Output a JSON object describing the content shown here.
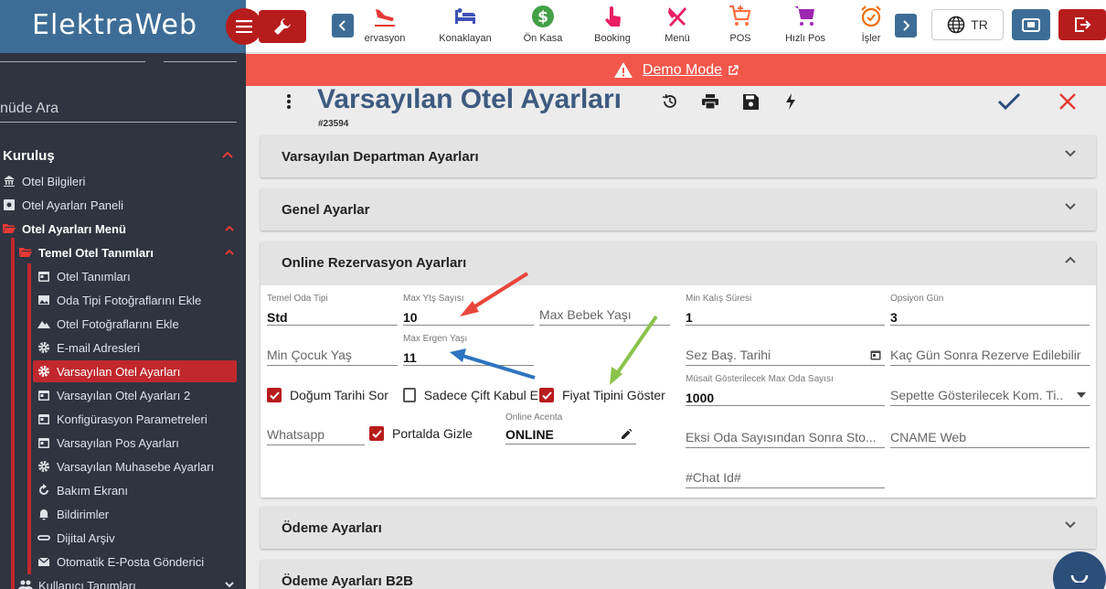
{
  "app": {
    "logo": "ElektraWeb"
  },
  "sidebar": {
    "search_placeholder": "nüde Ara",
    "section": "Kuruluş",
    "items": [
      {
        "label": "Otel Bilgileri"
      },
      {
        "label": "Otel Ayarları Paneli"
      },
      {
        "label": "Otel Ayarları Menü"
      },
      {
        "label": "Temel Otel Tanımları"
      },
      {
        "label": "Otel Tanımları"
      },
      {
        "label": "Oda Tipi Fotoğraflarını Ekle"
      },
      {
        "label": "Otel Fotoğraflarını Ekle"
      },
      {
        "label": "E-mail Adresleri"
      },
      {
        "label": "Varsayılan Otel Ayarları"
      },
      {
        "label": "Varsayılan Otel Ayarları 2"
      },
      {
        "label": "Konfigürasyon Parametreleri"
      },
      {
        "label": "Varsayılan Pos Ayarları"
      },
      {
        "label": "Varsayılan Muhasebe Ayarları"
      },
      {
        "label": "Bakım Ekranı"
      },
      {
        "label": "Bildirimler"
      },
      {
        "label": "Dijital Arşiv"
      },
      {
        "label": "Otomatik E-Posta Gönderici"
      },
      {
        "label": "Kullanıcı Tanımları"
      }
    ]
  },
  "topbar": {
    "modules": [
      {
        "label": "ervasyon",
        "color": "#e53935"
      },
      {
        "label": "Konaklayan",
        "color": "#3f51b5"
      },
      {
        "label": "Ön Kasa",
        "color": "#43a047"
      },
      {
        "label": "Booking",
        "color": "#e91e63"
      },
      {
        "label": "Menü",
        "color": "#e91e63"
      },
      {
        "label": "POS",
        "color": "#ff7043"
      },
      {
        "label": "Hızlı Pos",
        "color": "#9c27b0"
      },
      {
        "label": "İşler",
        "color": "#ef6c00"
      }
    ],
    "language": "TR"
  },
  "demo_banner": {
    "text": "Demo Mode"
  },
  "page": {
    "title": "Varsayılan Otel Ayarları",
    "id": "#23594"
  },
  "panels": [
    {
      "title": "Varsayılan Departman Ayarları"
    },
    {
      "title": "Genel Ayarlar"
    },
    {
      "title": "Online Rezervasyon Ayarları"
    },
    {
      "title": "Ödeme Ayarları"
    },
    {
      "title": "Ödeme Ayarları B2B"
    }
  ],
  "form": {
    "temel_oda_tipi": {
      "label": "Temel Oda Tipi",
      "value": "Std"
    },
    "max_yts_sayisi": {
      "label": "Max Ytş Sayısı",
      "value": "10"
    },
    "max_bebek_yasi": {
      "placeholder": "Max Bebek Yaşı"
    },
    "min_kalis_suresi": {
      "label": "Min Kalış Süresi",
      "value": "1"
    },
    "opsiyon_gun": {
      "label": "Opsiyon Gün",
      "value": "3"
    },
    "min_cocuk_yas": {
      "placeholder": "Min Çocuk Yaş"
    },
    "max_ergen_yasi": {
      "label": "Max Ergen Yaşı",
      "value": "11"
    },
    "sez_bas_tarihi": {
      "placeholder": "Sez Baş. Tarihi"
    },
    "kac_gun_sonra": {
      "placeholder": "Kaç Gün Sonra Rezerve Edilebilir"
    },
    "dogum_tarihi_sor": {
      "label": "Doğum Tarihi Sor",
      "checked": true
    },
    "sadece_cift_kabul": {
      "label": "Sadece Çift Kabul E",
      "checked": false
    },
    "fiyat_tipini_goster": {
      "label": "Fiyat Tipini Göster",
      "checked": true
    },
    "musait_max_oda": {
      "label": "Müsait Gösterilecek Max Oda Sayısı",
      "value": "1000"
    },
    "sepette_kom": {
      "placeholder": "Sepette Gösterilecek Kom. Ti..."
    },
    "whatsapp": {
      "placeholder": "Whatsapp"
    },
    "portalda_gizle": {
      "label": "Portalda Gizle",
      "checked": true
    },
    "online_acenta": {
      "label": "Online Acenta",
      "value": "ONLINE"
    },
    "eksi_oda": {
      "placeholder": "Eksi Oda Sayısından Sonra Sto..."
    },
    "cname_web": {
      "placeholder": "CNAME Web"
    },
    "chat_id": {
      "placeholder": "#Chat Id#"
    }
  }
}
